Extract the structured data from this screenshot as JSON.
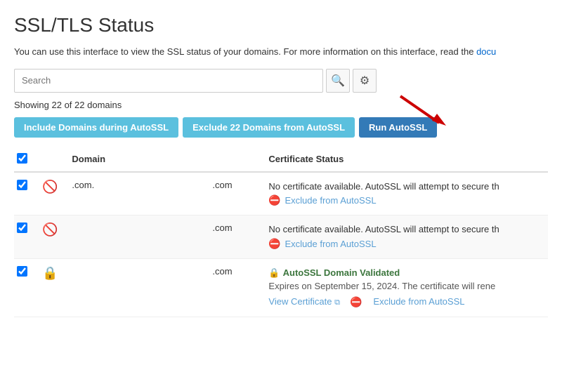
{
  "page": {
    "title": "SSL/TLS Status",
    "description_start": "You can use this interface to view the SSL status of your domains. For more information on this interface, read the ",
    "description_link_text": "docu",
    "description_link_href": "#"
  },
  "search": {
    "placeholder": "Search"
  },
  "showing": {
    "label": "Showing",
    "count": "22 of 22",
    "suffix": "domains"
  },
  "buttons": {
    "include": "Include Domains during AutoSSL",
    "exclude": "Exclude 22 Domains from AutoSSL",
    "run": "Run AutoSSL"
  },
  "table": {
    "headers": [
      "",
      "",
      "Domain",
      "",
      "Certificate Status"
    ],
    "rows": [
      {
        "checked": true,
        "status_icon": "no-cert",
        "domain": ".com.",
        "type": ".com",
        "cert_status": "No certificate available. AutoSSL will attempt to secure th",
        "actions": [
          "Exclude from AutoSSL"
        ]
      },
      {
        "checked": true,
        "status_icon": "no-cert",
        "domain": "",
        "type": ".com",
        "cert_status": "No certificate available. AutoSSL will attempt to secure th",
        "actions": [
          "Exclude from AutoSSL"
        ]
      },
      {
        "checked": true,
        "status_icon": "validated",
        "domain": "",
        "type": ".com",
        "cert_status_title": "AutoSSL Domain Validated",
        "cert_expires": "Expires on September 15, 2024. The certificate will rene",
        "actions": [
          "View Certificate",
          "Exclude from AutoSSL"
        ]
      }
    ]
  }
}
